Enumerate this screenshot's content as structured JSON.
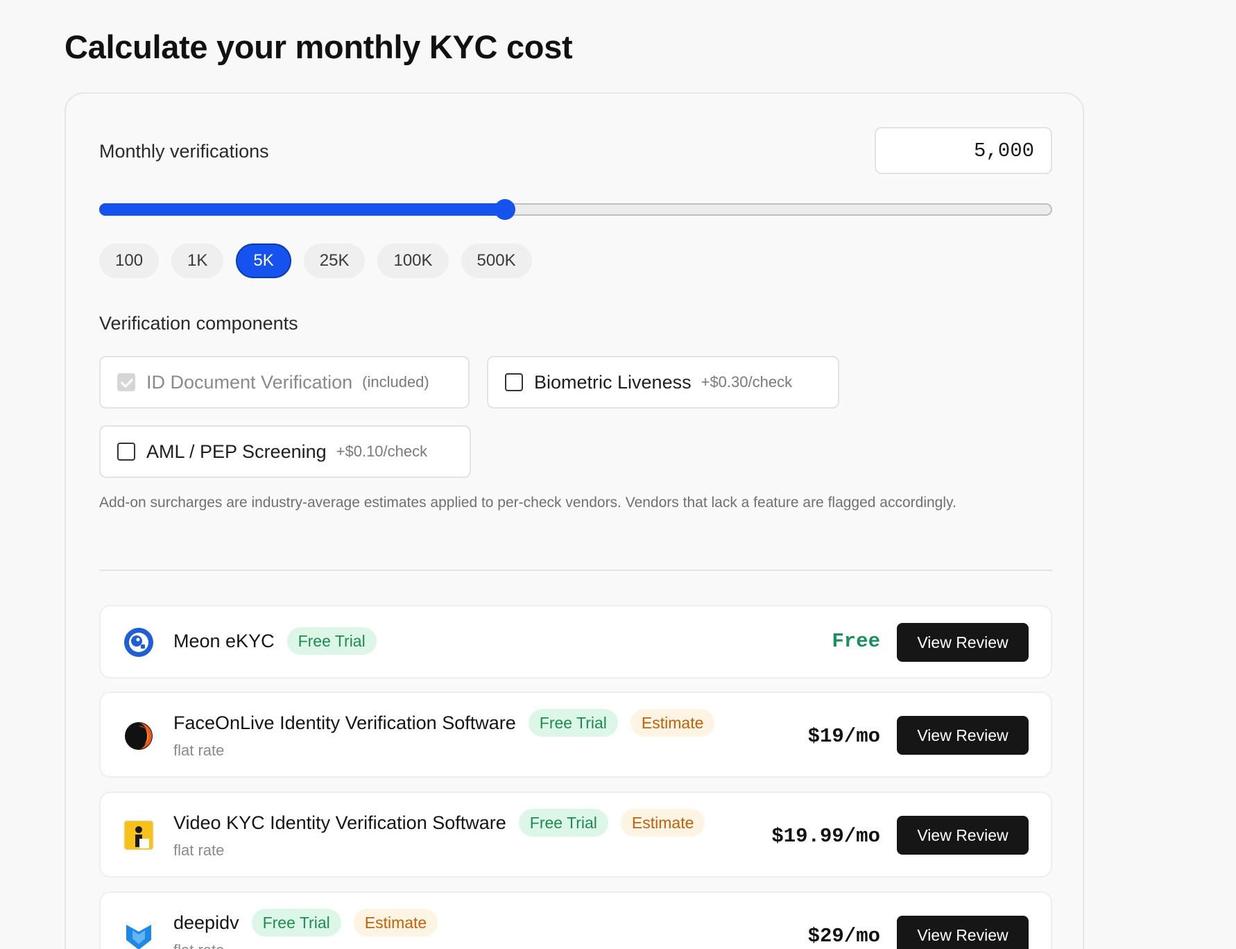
{
  "page": {
    "title": "Calculate your monthly KYC cost"
  },
  "calculator": {
    "monthly_label": "Monthly verifications",
    "monthly_value": "5,000",
    "slider_level_percent": 42.6,
    "presets": [
      "100",
      "1K",
      "5K",
      "25K",
      "100K",
      "500K"
    ],
    "active_preset": "5K",
    "components_label": "Verification components",
    "components": [
      {
        "name": "ID Document Verification",
        "price": "(included)",
        "checked": true,
        "disabled": true
      },
      {
        "name": "Biometric Liveness",
        "price": "+$0.30/check",
        "checked": false,
        "disabled": false
      },
      {
        "name": "AML / PEP Screening",
        "price": "+$0.10/check",
        "checked": false,
        "disabled": false
      }
    ],
    "note": "Add-on surcharges are industry-average estimates applied to per-check vendors. Vendors that lack a feature are flagged accordingly."
  },
  "vendors": [
    {
      "name": "Meon eKYC",
      "trial_badge": "Free Trial",
      "estimate_badge": "",
      "subtitle": "",
      "price": "Free",
      "button": "View Review",
      "logo_icon": "meon-logo-icon",
      "logo_color": "#1f5fd6"
    },
    {
      "name": "FaceOnLive Identity Verification Software",
      "trial_badge": "Free Trial",
      "estimate_badge": "Estimate",
      "subtitle": "flat rate",
      "price": "$19/mo",
      "button": "View Review",
      "logo_icon": "faceonlive-logo-icon",
      "logo_color": "#ee5a24"
    },
    {
      "name": "Video KYC Identity Verification Software",
      "trial_badge": "Free Trial",
      "estimate_badge": "Estimate",
      "subtitle": "flat rate",
      "price": "$19.99/mo",
      "button": "View Review",
      "logo_icon": "videokyc-logo-icon",
      "logo_color": "#f6c21a"
    },
    {
      "name": "deepidv",
      "trial_badge": "Free Trial",
      "estimate_badge": "Estimate",
      "subtitle": "flat rate",
      "price": "$29/mo",
      "button": "View Review",
      "logo_icon": "deepidv-logo-icon",
      "logo_color": "#1e88e5"
    }
  ],
  "colors": {
    "accent": "#1552ee",
    "trial_text": "#1f8a52",
    "trial_bg": "#dcf7e7",
    "estimate_text": "#c2610c",
    "estimate_bg": "#fdf4e3"
  }
}
